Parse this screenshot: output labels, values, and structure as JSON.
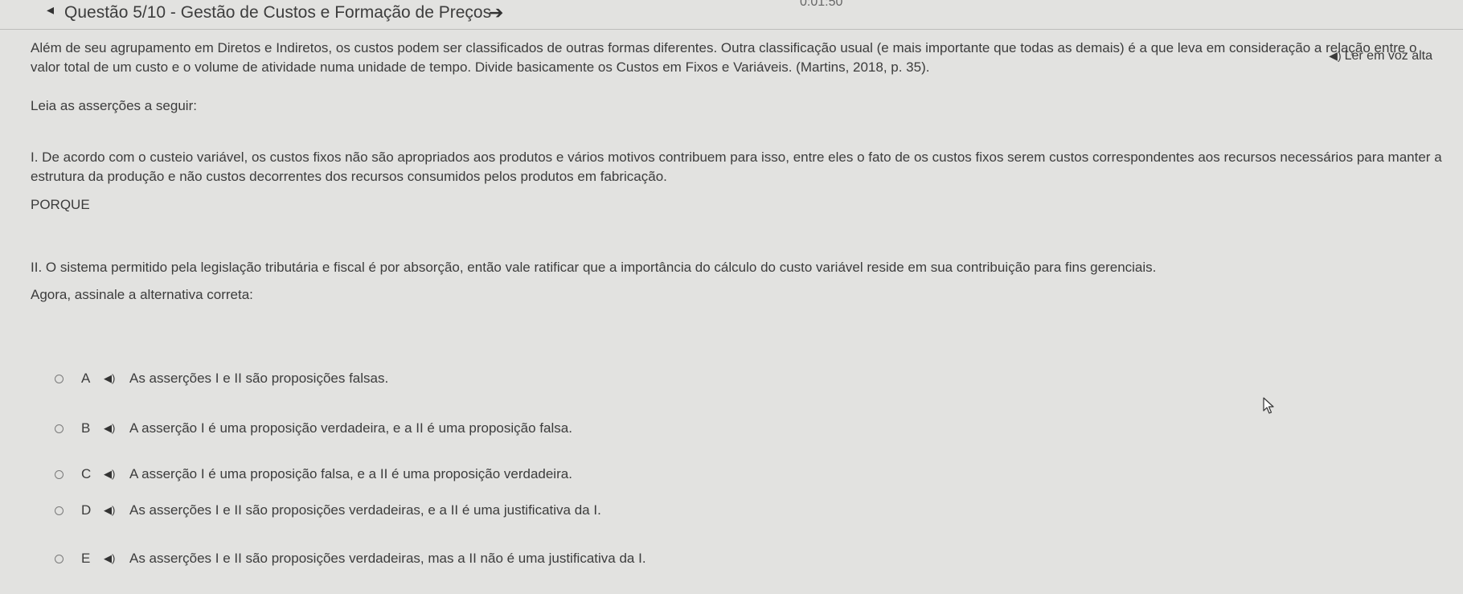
{
  "header": {
    "back_icon": "◂",
    "title": "Questão 5/10 - Gestão de Custos e Formação de Preços",
    "next_icon": "➔",
    "timer": "0:01:50"
  },
  "read_aloud": {
    "icon": "◀)",
    "label": "Ler em voz alta"
  },
  "content": {
    "intro": "Além de seu agrupamento em Diretos e Indiretos, os custos podem ser classificados de outras formas diferentes. Outra classificação usual (e mais importante que todas as demais) é a que leva em consideração a relação entre o valor total de um custo e o volume de atividade numa unidade de tempo. Divide basicamente os Custos em Fixos e Variáveis. (Martins, 2018, p. 35).",
    "leia": "Leia as asserções a seguir:",
    "assertion_i": "I. De acordo com o custeio variável, os custos fixos não são apropriados aos produtos e vários motivos contribuem para isso, entre eles o fato de os custos fixos serem custos correspondentes aos recursos necessários para manter a estrutura da produção e não custos decorrentes dos recursos consumidos pelos produtos em fabricação.",
    "porque": "PORQUE",
    "assertion_ii": "II. O sistema permitido pela legislação tributária e fiscal é por absorção, então vale ratificar que a importância do cálculo do custo variável reside em sua contribuição para fins gerenciais.",
    "agora": "Agora, assinale a alternativa correta:"
  },
  "options": [
    {
      "letter": "A",
      "speaker": "◀)",
      "text": "As asserções I e II são proposições falsas."
    },
    {
      "letter": "B",
      "speaker": "◀)",
      "text": "A asserção I é uma proposição verdadeira, e a II é uma proposição falsa."
    },
    {
      "letter": "C",
      "speaker": "◀)",
      "text": "A asserção I é uma proposição falsa, e a II é uma proposição verdadeira."
    },
    {
      "letter": "D",
      "speaker": "◀)",
      "text": "As asserções I e II são proposições verdadeiras, e a II é uma justificativa da I."
    },
    {
      "letter": "E",
      "speaker": "◀)",
      "text": "As asserções I e II são proposições verdadeiras, mas a II não é uma justificativa da I."
    }
  ],
  "colors": {
    "background": "#e2e2e0",
    "text": "#3c3c3c",
    "radio_border": "#7a7a7a"
  }
}
